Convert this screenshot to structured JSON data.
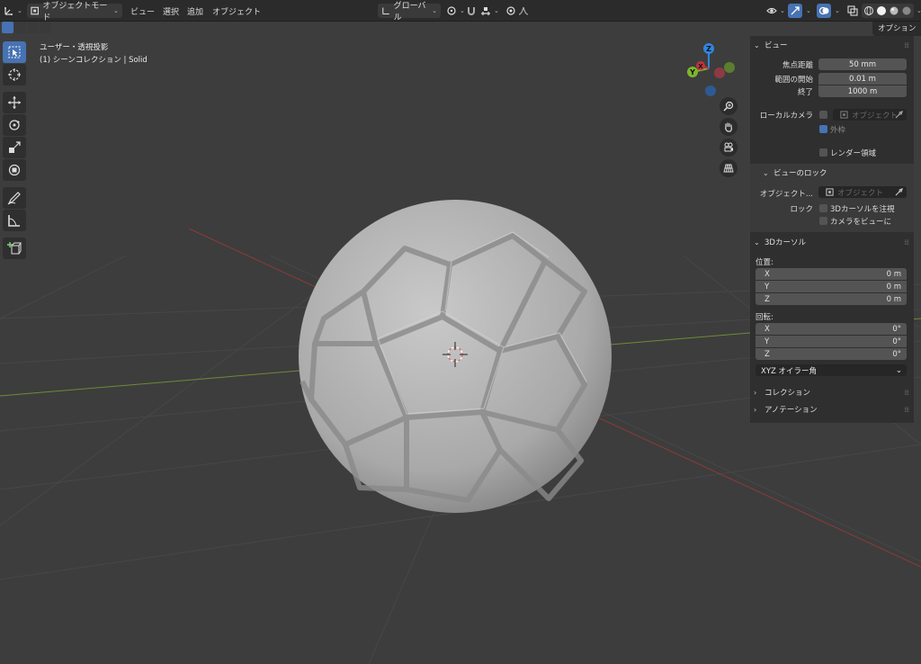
{
  "header": {
    "mode_label": "オブジェクトモード",
    "menus": [
      "ビュー",
      "選択",
      "追加",
      "オブジェクト"
    ],
    "transform_orientation": "グローバル",
    "options_tab": "オプション"
  },
  "viewport": {
    "view_name": "ユーザー・透視投影",
    "collection_info": "(1) シーンコレクション | Solid",
    "gizmo": {
      "z": "Z",
      "y": "Y",
      "x": "X"
    }
  },
  "sidebar": {
    "view_panel": {
      "title": "ビュー",
      "focal_length_label": "焦点距離",
      "focal_length_value": "50 mm",
      "clip_start_label": "範囲の開始",
      "clip_start_value": "0.01 m",
      "clip_end_label": "終了",
      "clip_end_value": "1000 m",
      "local_camera_label": "ローカルカメラ",
      "object_placeholder": "オブジェクト",
      "border_label": "外枠",
      "render_region_label": "レンダー領域"
    },
    "view_lock": {
      "title": "ビューのロック",
      "object_label": "オブジェクト...",
      "object_placeholder": "オブジェクト",
      "lock_label": "ロック",
      "lock_3d_cursor": "3Dカーソルを注視",
      "camera_to_view": "カメラをビューに"
    },
    "cursor_panel": {
      "title": "3Dカーソル",
      "location_label": "位置:",
      "location": [
        {
          "axis": "X",
          "value": "0 m"
        },
        {
          "axis": "Y",
          "value": "0 m"
        },
        {
          "axis": "Z",
          "value": "0 m"
        }
      ],
      "rotation_label": "回転:",
      "rotation": [
        {
          "axis": "X",
          "value": "0°"
        },
        {
          "axis": "Y",
          "value": "0°"
        },
        {
          "axis": "Z",
          "value": "0°"
        }
      ],
      "rotation_mode": "XYZ オイラー角"
    },
    "collection_panel": {
      "title": "コレクション"
    },
    "annotation_panel": {
      "title": "アノテーション"
    }
  },
  "colors": {
    "accent": "#4772b3",
    "x_axis": "#c0323f",
    "y_axis": "#7cb62e",
    "z_axis": "#2f85e0",
    "viewport_bg": "#3d3d3d"
  }
}
